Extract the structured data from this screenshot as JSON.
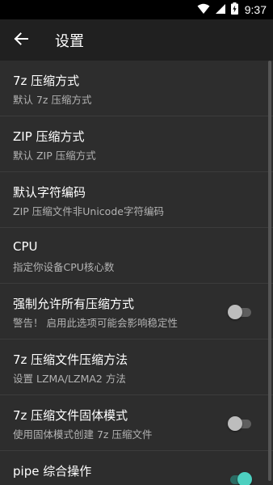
{
  "status_bar": {
    "time": "9:37",
    "icons": [
      "wifi-icon",
      "signal-icon",
      "battery-charging-icon"
    ]
  },
  "app_bar": {
    "back_icon": "arrow-back-icon",
    "title": "设置"
  },
  "settings": [
    {
      "title": "7z 压缩方式",
      "subtitle": "默认 7z 压缩方式"
    },
    {
      "title": "ZIP 压缩方式",
      "subtitle": "默认 ZIP 压缩方式"
    },
    {
      "title": "默认字符编码",
      "subtitle": "ZIP 压缩文件非Unicode字符编码"
    },
    {
      "title": "CPU",
      "subtitle": "指定你设备CPU核心数"
    },
    {
      "title": "强制允许所有压缩方式",
      "subtitle": "警告！ 启用此选项可能会影响稳定性",
      "switch": "off"
    },
    {
      "title": "7z 压缩文件压缩方法",
      "subtitle": "设置 LZMA/LZMA2 方法"
    },
    {
      "title": "7z 压缩文件固体模式",
      "subtitle": "使用固体模式创建 7z 压缩文件",
      "switch": "off"
    },
    {
      "title": "pipe 综合操作",
      "subtitle": "",
      "switch": "on"
    }
  ],
  "colors": {
    "background": "#2d2d2d",
    "app_bar": "#202020",
    "accent": "#4dd0c0",
    "secondary_text": "#b3b3b3"
  }
}
